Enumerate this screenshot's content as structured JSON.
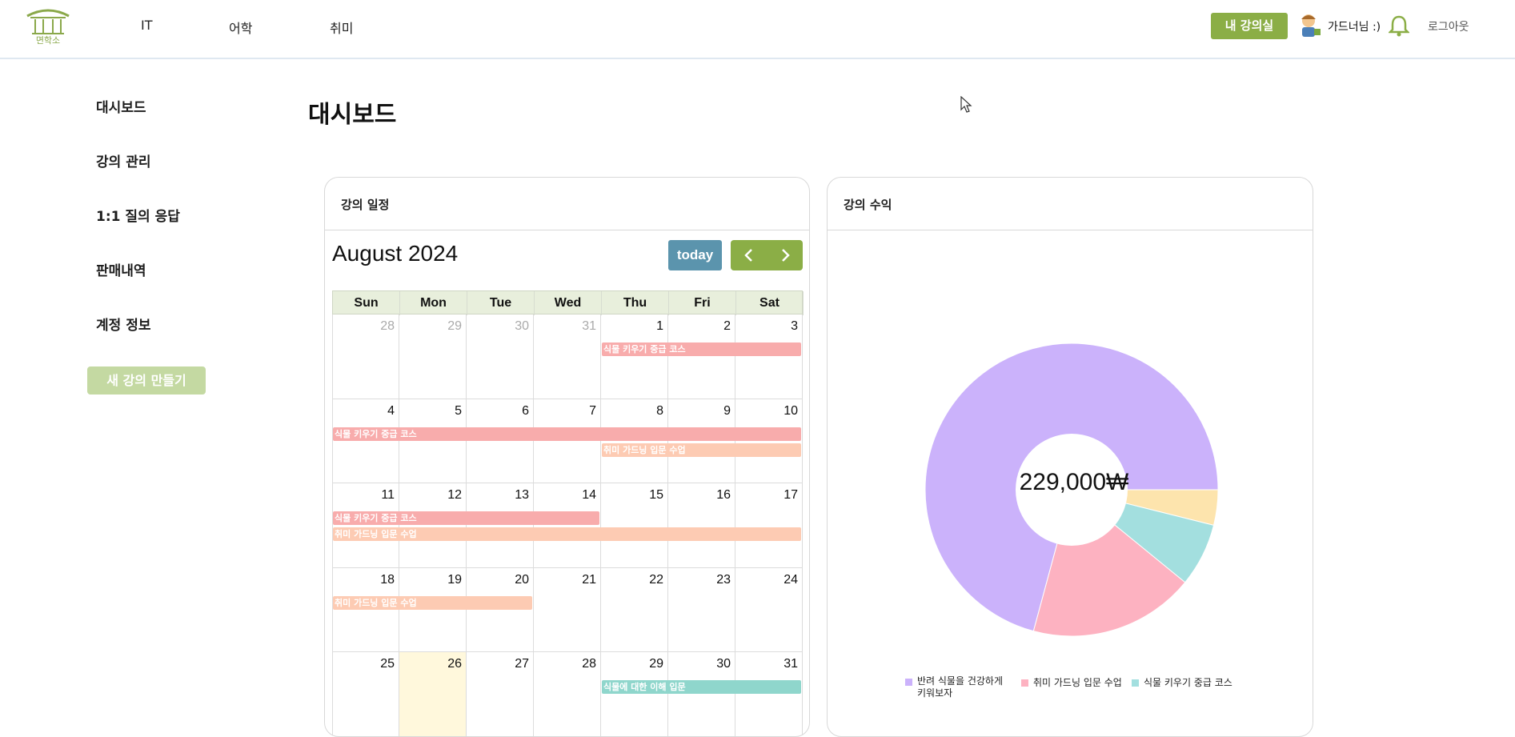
{
  "header": {
    "logo_text": "면학소",
    "nav": [
      "IT",
      "어학",
      "취미"
    ],
    "my_class_label": "내 강의실",
    "user_name": "가드너님 :)",
    "logout_label": "로그아웃"
  },
  "sidebar": {
    "items": [
      "대시보드",
      "강의 관리",
      "1:1 질의 응답",
      "판매내역",
      "계정 정보"
    ],
    "new_course_label": "새 강의 만들기"
  },
  "page": {
    "title": "대시보드"
  },
  "schedule": {
    "card_title": "강의 일정",
    "month": "August 2024",
    "today_label": "today",
    "prev_icon": "chevron-left-icon",
    "next_icon": "chevron-right-icon",
    "weekdays": [
      "Sun",
      "Mon",
      "Tue",
      "Wed",
      "Thu",
      "Fri",
      "Sat"
    ],
    "weeks": [
      [
        {
          "d": "28",
          "m": true
        },
        {
          "d": "29",
          "m": true
        },
        {
          "d": "30",
          "m": true
        },
        {
          "d": "31",
          "m": true
        },
        {
          "d": "1"
        },
        {
          "d": "2"
        },
        {
          "d": "3"
        }
      ],
      [
        {
          "d": "4"
        },
        {
          "d": "5"
        },
        {
          "d": "6"
        },
        {
          "d": "7"
        },
        {
          "d": "8"
        },
        {
          "d": "9"
        },
        {
          "d": "10"
        }
      ],
      [
        {
          "d": "11"
        },
        {
          "d": "12"
        },
        {
          "d": "13"
        },
        {
          "d": "14"
        },
        {
          "d": "15"
        },
        {
          "d": "16"
        },
        {
          "d": "17"
        }
      ],
      [
        {
          "d": "18"
        },
        {
          "d": "19"
        },
        {
          "d": "20"
        },
        {
          "d": "21"
        },
        {
          "d": "22"
        },
        {
          "d": "23"
        },
        {
          "d": "24"
        }
      ],
      [
        {
          "d": "25"
        },
        {
          "d": "26",
          "today": true
        },
        {
          "d": "27"
        },
        {
          "d": "28"
        },
        {
          "d": "29"
        },
        {
          "d": "30"
        },
        {
          "d": "31"
        }
      ]
    ],
    "events": [
      {
        "title": "식물 키우기 중급 코스",
        "week": 0,
        "start": 4,
        "end": 6,
        "row": 0,
        "color": "#f8acac"
      },
      {
        "title": "식물 키우기 중급 코스",
        "week": 1,
        "start": 0,
        "end": 6,
        "row": 0,
        "color": "#f8acac"
      },
      {
        "title": "취미 가드닝 입문 수업",
        "week": 1,
        "start": 4,
        "end": 6,
        "row": 1,
        "color": "#fdcbb3"
      },
      {
        "title": "식물 키우기 중급 코스",
        "week": 2,
        "start": 0,
        "end": 3,
        "row": 0,
        "color": "#f8acac"
      },
      {
        "title": "취미 가드닝 입문 수업",
        "week": 2,
        "start": 0,
        "end": 6,
        "row": 1,
        "color": "#fdcbb3"
      },
      {
        "title": "취미 가드닝 입문 수업",
        "week": 3,
        "start": 0,
        "end": 2,
        "row": 0,
        "color": "#fdcbb3"
      },
      {
        "title": "식물에 대한 이해 입문",
        "week": 4,
        "start": 4,
        "end": 6,
        "row": 0,
        "color": "#8fd6cc"
      }
    ]
  },
  "revenue": {
    "card_title": "강의 수익",
    "total": "229,000₩",
    "legend": [
      {
        "label": "반려 식물을 건강하게 키워보자",
        "color": "#cbb2fb"
      },
      {
        "label": "취미 가드닝 입문 수업",
        "color": "#fdb2c1"
      },
      {
        "label": "식물 키우기 중급 코스",
        "color": "#a3dfdf"
      }
    ]
  },
  "chart_data": {
    "type": "pie",
    "categories": [
      "반려 식물을 건강하게 키워보자",
      "취미 가드닝 입문 수업",
      "식물 키우기 중급 코스",
      ""
    ],
    "values": [
      70.8,
      18.3,
      7.0,
      3.9
    ],
    "colors": [
      "#cbb2fb",
      "#fdb2c1",
      "#a3dfdf",
      "#fde4ad"
    ],
    "title": "",
    "center_label": "229,000₩"
  }
}
